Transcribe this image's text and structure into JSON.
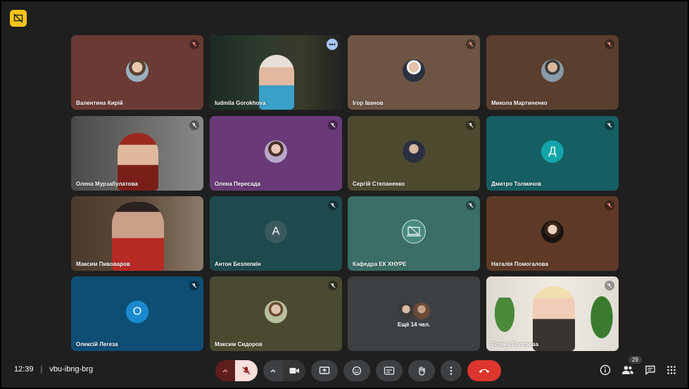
{
  "meeting": {
    "time": "12:39",
    "code": "vbu-ibng-brg",
    "participants_count": "29"
  },
  "tiles": [
    {
      "name": "Валентина Кирій"
    },
    {
      "name": "Iudmila Gorokhova"
    },
    {
      "name": "Ігор Іванов"
    },
    {
      "name": "Микола Мартиненко"
    },
    {
      "name": "Олена Мурзабулатова"
    },
    {
      "name": "Олена Пересада"
    },
    {
      "name": "Сергій Степаненко"
    },
    {
      "name": "Дмитро Толмачов",
      "letter": "Д"
    },
    {
      "name": "Максим Пивоваров"
    },
    {
      "name": "Антон Безлепкін",
      "letter": "А"
    },
    {
      "name": "Кафедра ЕК ХНУРЕ"
    },
    {
      "name": "Наталія Помогалова"
    },
    {
      "name": "Олексій Легеза",
      "letter": "О"
    },
    {
      "name": "Максим Сидоров"
    },
    {
      "name": "Ещё 14 чел."
    },
    {
      "name": "Тетяна Полозова"
    }
  ],
  "icons": {
    "menu_dots": "•••"
  }
}
